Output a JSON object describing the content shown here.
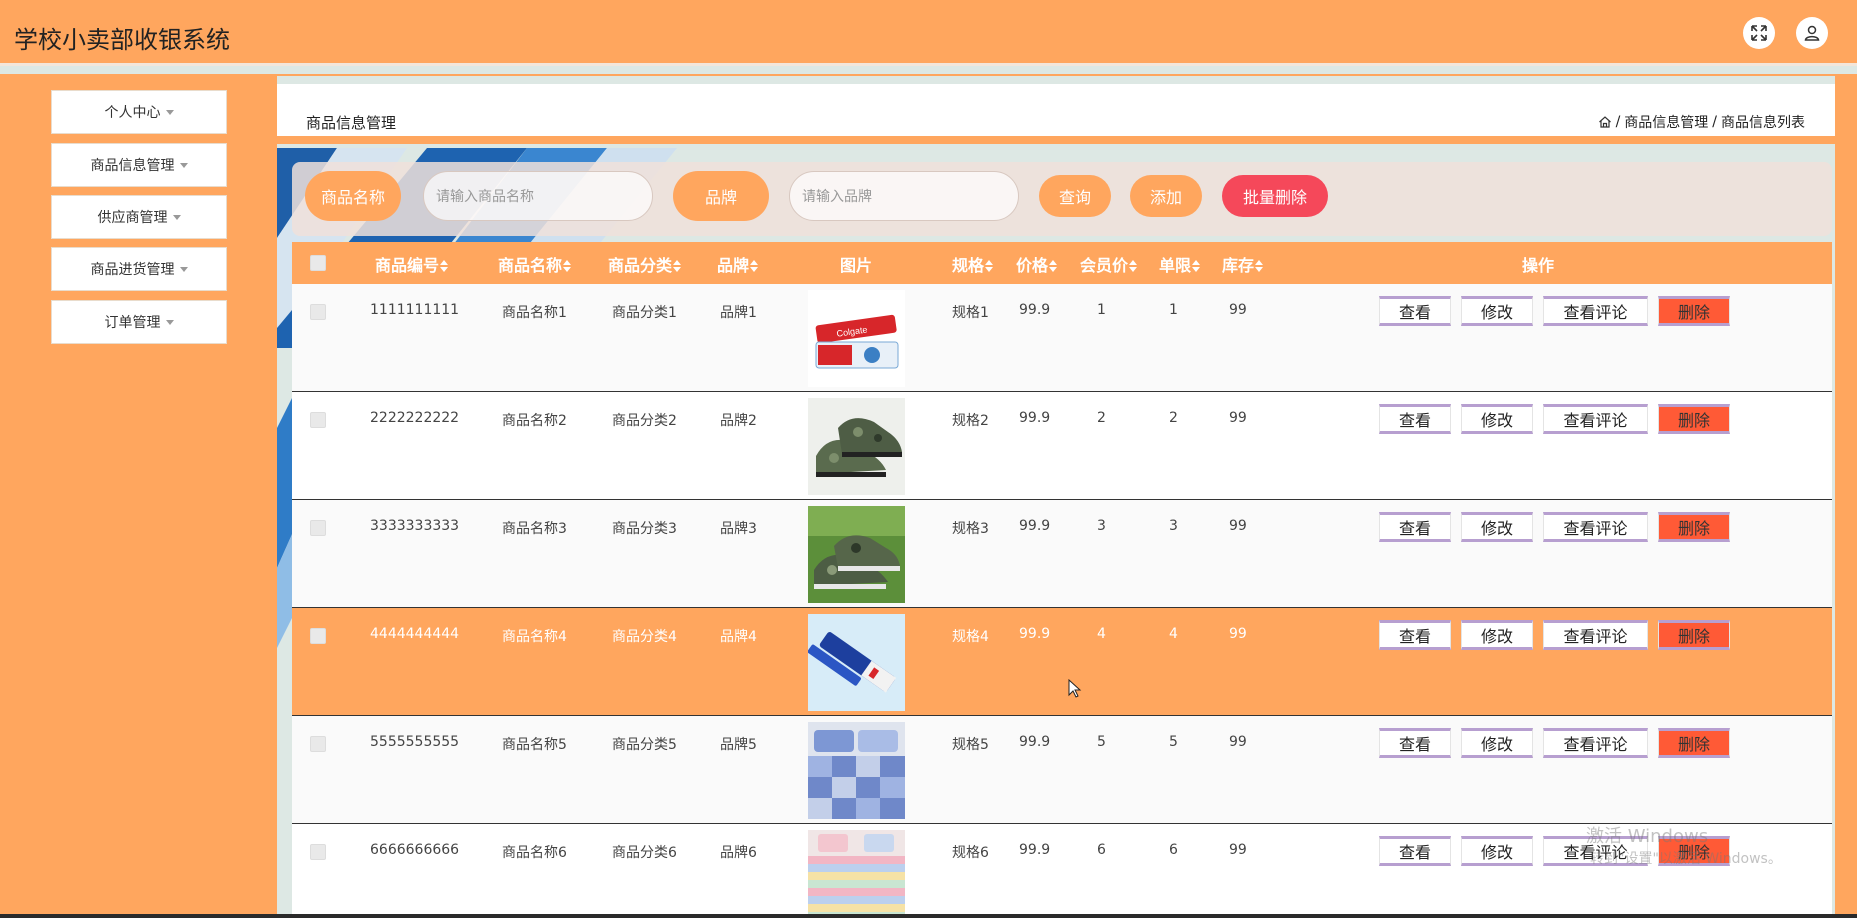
{
  "app": {
    "title": "学校小卖部收银系统"
  },
  "header_icons": {
    "fullscreen": "fullscreen-icon",
    "user": "user-icon"
  },
  "sidebar": {
    "items": [
      {
        "label": "个人中心"
      },
      {
        "label": "商品信息管理"
      },
      {
        "label": "供应商管理"
      },
      {
        "label": "商品进货管理"
      },
      {
        "label": "订单管理"
      }
    ]
  },
  "breadcrumb": {
    "title": "商品信息管理",
    "home_icon": "home-icon",
    "sep": "/",
    "level1": "商品信息管理",
    "level2": "商品信息列表"
  },
  "search": {
    "name_label": "商品名称",
    "name_placeholder": "请输入商品名称",
    "brand_label": "品牌",
    "brand_placeholder": "请输入品牌",
    "query_btn": "查询",
    "add_btn": "添加",
    "batch_delete_btn": "批量删除"
  },
  "table": {
    "headers": {
      "code": "商品编号",
      "name": "商品名称",
      "category": "商品分类",
      "brand": "品牌",
      "image": "图片",
      "spec": "规格",
      "price": "价格",
      "member_price": "会员价",
      "limit": "单限",
      "stock": "库存",
      "ops": "操作"
    },
    "op_labels": {
      "view": "查看",
      "edit": "修改",
      "reviews": "查看评论",
      "delete": "删除"
    },
    "rows": [
      {
        "code": "1111111111",
        "name": "商品名称1",
        "category": "商品分类1",
        "brand": "品牌1",
        "image": "toothpaste",
        "spec": "规格1",
        "price": "99.9",
        "member_price": "1",
        "limit": "1",
        "stock": "99"
      },
      {
        "code": "2222222222",
        "name": "商品名称2",
        "category": "商品分类2",
        "brand": "品牌2",
        "image": "camo-shoes",
        "spec": "规格2",
        "price": "99.9",
        "member_price": "2",
        "limit": "2",
        "stock": "99"
      },
      {
        "code": "3333333333",
        "name": "商品名称3",
        "category": "商品分类3",
        "brand": "品牌3",
        "image": "camo-shoes-grass",
        "spec": "规格3",
        "price": "99.9",
        "member_price": "3",
        "limit": "3",
        "stock": "99"
      },
      {
        "code": "4444444444",
        "name": "商品名称4",
        "category": "商品分类4",
        "brand": "品牌4",
        "image": "blue-toothpaste",
        "spec": "规格4",
        "price": "99.9",
        "member_price": "4",
        "limit": "4",
        "stock": "99"
      },
      {
        "code": "5555555555",
        "name": "商品名称5",
        "category": "商品分类5",
        "brand": "品牌5",
        "image": "plaid-bedding",
        "spec": "规格5",
        "price": "99.9",
        "member_price": "5",
        "limit": "5",
        "stock": "99"
      },
      {
        "code": "6666666666",
        "name": "商品名称6",
        "category": "商品分类6",
        "brand": "品牌6",
        "image": "striped-bedding",
        "spec": "规格6",
        "price": "99.9",
        "member_price": "6",
        "limit": "6",
        "stock": "99"
      }
    ]
  },
  "watermark": {
    "line1": "激活 Windows",
    "line2": "转到\"设置\"以激活 Windows。"
  },
  "colors": {
    "primary": "#ffa65e",
    "danger": "#ff5a36",
    "batch_delete": "#f5485a",
    "accent_border": "#b79fd0"
  }
}
